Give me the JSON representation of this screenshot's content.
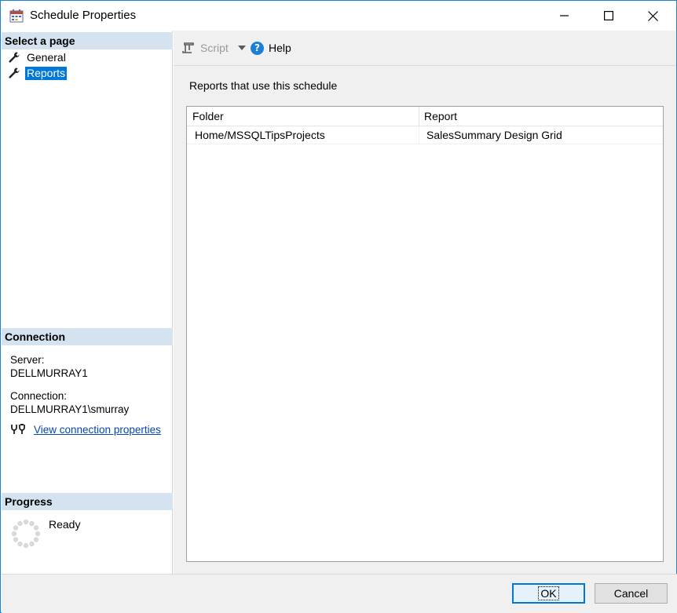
{
  "window": {
    "title": "Schedule Properties",
    "controls": [
      "minimize",
      "maximize",
      "close"
    ]
  },
  "left_panel": {
    "select_page_header": "Select a page",
    "pages": [
      {
        "label": "General",
        "icon": "wrench-icon",
        "selected": false
      },
      {
        "label": "Reports",
        "icon": "wrench-icon",
        "selected": true
      }
    ],
    "connection_header": "Connection",
    "server_label": "Server:",
    "server_value": "DELLMURRAY1",
    "connection_label": "Connection:",
    "connection_value": "DELLMURRAY1\\smurray",
    "view_connection_link": "View connection properties",
    "progress_header": "Progress",
    "progress_status": "Ready"
  },
  "toolbar": {
    "script_label": "Script",
    "help_label": "Help"
  },
  "main": {
    "section_label": "Reports that use this schedule",
    "columns": [
      "Folder",
      "Report"
    ],
    "rows": [
      {
        "folder": "Home/MSSQLTipsProjects",
        "report": "SalesSummary Design Grid"
      }
    ]
  },
  "footer": {
    "ok_label": "OK",
    "cancel_label": "Cancel"
  },
  "colors": {
    "window_border": "#1883d7",
    "section_header_bg": "#d4e3ef",
    "selected_bg": "#0078d7",
    "link": "#0645ad",
    "help_icon": "#1c7fd6"
  }
}
